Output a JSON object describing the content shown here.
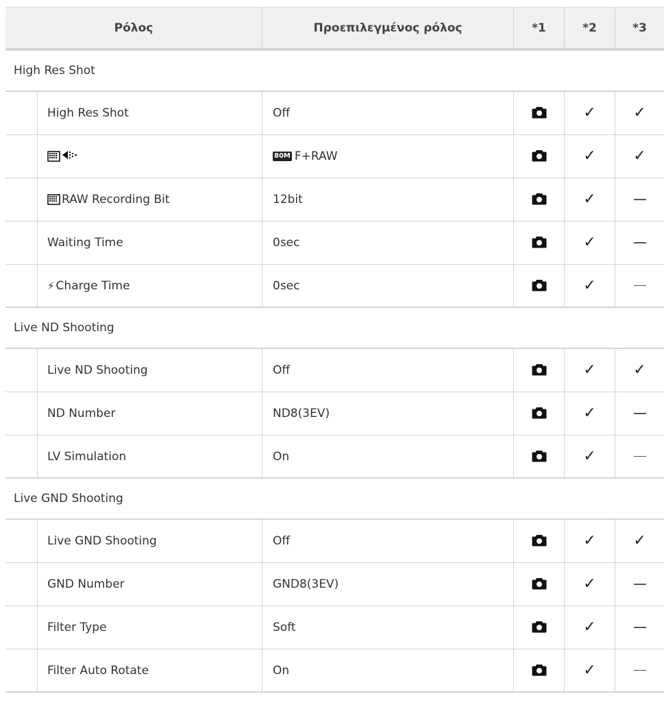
{
  "header": {
    "role": "Ρόλος",
    "default": "Προεπιλεγμένος ρόλος",
    "c1": "*1",
    "c2": "*2",
    "c3": "*3"
  },
  "groups": [
    {
      "title": "High Res Shot",
      "rows": [
        {
          "label": "High Res Shot",
          "value": "Off",
          "c3": "check"
        },
        {
          "label": "",
          "value": "F+RAW",
          "badge": "80M",
          "c3": "check"
        },
        {
          "label": "RAW Recording Bit",
          "value": "12bit",
          "c3": "dash"
        },
        {
          "label": "Waiting Time",
          "value": "0sec",
          "c3": "dash"
        },
        {
          "label": "Charge Time",
          "value": "0sec",
          "c3": "dash"
        }
      ]
    },
    {
      "title": "Live ND Shooting",
      "rows": [
        {
          "label": "Live ND Shooting",
          "value": "Off",
          "c3": "check"
        },
        {
          "label": "ND Number",
          "value": "ND8(3EV)",
          "c3": "dash"
        },
        {
          "label": "LV Simulation",
          "value": "On",
          "c3": "dash"
        }
      ]
    },
    {
      "title": "Live GND Shooting",
      "rows": [
        {
          "label": "Live GND Shooting",
          "value": "Off",
          "c3": "check"
        },
        {
          "label": "GND Number",
          "value": "GND8(3EV)",
          "c3": "dash"
        },
        {
          "label": "Filter Type",
          "value": "Soft",
          "c3": "dash"
        },
        {
          "label": "Filter Auto Rotate",
          "value": "On",
          "c3": "dash"
        }
      ]
    }
  ],
  "icons": {
    "col1": "camera-icon",
    "col2": "check-icon",
    "check": "check-icon",
    "dash": "dash-icon"
  }
}
